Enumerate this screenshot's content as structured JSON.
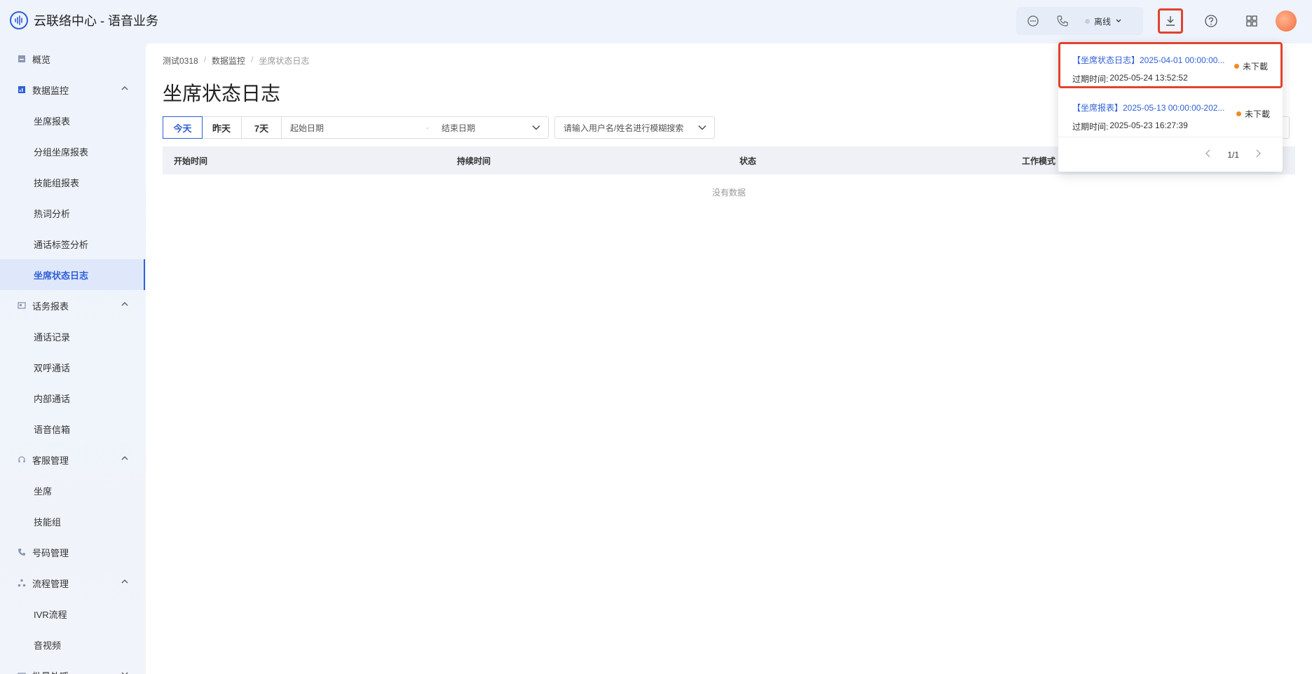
{
  "app": {
    "title": "云联络中心 - 语音业务"
  },
  "topbar": {
    "status_label": "离线"
  },
  "sidebar": {
    "items": [
      {
        "label": "概览",
        "type": "top",
        "icon": "overview-icon"
      },
      {
        "label": "数据监控",
        "type": "group",
        "icon": "monitor-icon"
      },
      {
        "label": "坐席报表",
        "type": "sub"
      },
      {
        "label": "分组坐席报表",
        "type": "sub"
      },
      {
        "label": "技能组报表",
        "type": "sub"
      },
      {
        "label": "热词分析",
        "type": "sub"
      },
      {
        "label": "通话标签分析",
        "type": "sub"
      },
      {
        "label": "坐席状态日志",
        "type": "sub",
        "active": true
      },
      {
        "label": "话务报表",
        "type": "group",
        "icon": "report-icon"
      },
      {
        "label": "通话记录",
        "type": "sub"
      },
      {
        "label": "双呼通话",
        "type": "sub"
      },
      {
        "label": "内部通话",
        "type": "sub"
      },
      {
        "label": "语音信箱",
        "type": "sub"
      },
      {
        "label": "客服管理",
        "type": "group",
        "icon": "headset-icon"
      },
      {
        "label": "坐席",
        "type": "sub"
      },
      {
        "label": "技能组",
        "type": "sub"
      },
      {
        "label": "号码管理",
        "type": "top",
        "icon": "phone-icon"
      },
      {
        "label": "流程管理",
        "type": "group",
        "icon": "flow-icon"
      },
      {
        "label": "IVR流程",
        "type": "sub"
      },
      {
        "label": "音视频",
        "type": "sub"
      },
      {
        "label": "批量外呼",
        "type": "group",
        "icon": "batch-icon"
      }
    ]
  },
  "breadcrumb": [
    "测试0318",
    "数据监控",
    "坐席状态日志"
  ],
  "page": {
    "title": "坐席状态日志"
  },
  "filters": {
    "quick": [
      "今天",
      "昨天",
      "7天"
    ],
    "active_quick": "今天",
    "start_placeholder": "起始日期",
    "separator": "-",
    "end_placeholder": "结束日期",
    "search_placeholder": "请输入用户名/姓名进行模糊搜索"
  },
  "table": {
    "columns": [
      "开始时间",
      "持续时间",
      "状态",
      "工作模式"
    ],
    "empty_text": "没有数据"
  },
  "downloads": {
    "items": [
      {
        "name": "【坐席状态日志】2025-04-01 00:00:00...",
        "expire_label": "过期时间:",
        "expire_time": "2025-05-24 13:52:52",
        "status": "未下載"
      },
      {
        "name": "【坐席报表】2025-05-13 00:00:00-202...",
        "expire_label": "过期时间:",
        "expire_time": "2025-05-23 16:27:39",
        "status": "未下載"
      }
    ],
    "page_indicator": "1/1"
  },
  "colors": {
    "accent": "#2f5fd6",
    "highlight": "#e2422d",
    "pending": "#f08a24"
  }
}
